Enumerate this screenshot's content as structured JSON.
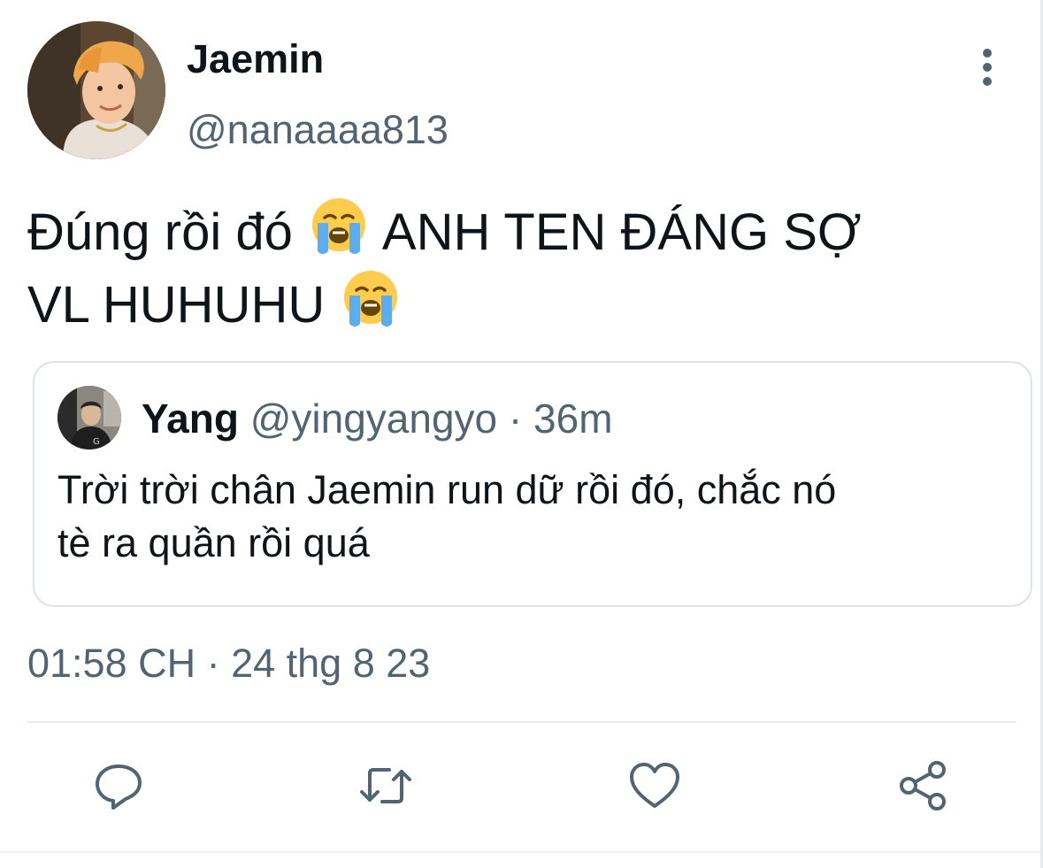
{
  "tweet": {
    "author": {
      "display_name": "Jaemin",
      "handle": "@nanaaaa813",
      "avatar": "avatar-photo"
    },
    "more_icon": "more-vertical-icon",
    "text_line1_a": "Đúng rồi đó ",
    "text_line1_b": " ANH TEN ĐÁNG SỢ",
    "text_line2": "VL HUHUHU ",
    "emoji": "loudly-crying-face-emoji",
    "timestamp": "01:58 CH · 24 thg 8 23"
  },
  "quote": {
    "display_name": "Yang",
    "handle": "@yingyangyo",
    "separator": "·",
    "time": "36m",
    "text_line1": "Trời trời chân Jaemin run dữ rồi đó, chắc nó",
    "text_line2": "tè ra quần rồi quá"
  },
  "actions": [
    {
      "name": "reply",
      "icon": "reply-icon"
    },
    {
      "name": "retweet",
      "icon": "retweet-icon"
    },
    {
      "name": "like",
      "icon": "heart-icon"
    },
    {
      "name": "share",
      "icon": "share-icon"
    }
  ],
  "colors": {
    "text_primary": "#0f1419",
    "text_secondary": "#536471",
    "border": "#dde3e8"
  }
}
